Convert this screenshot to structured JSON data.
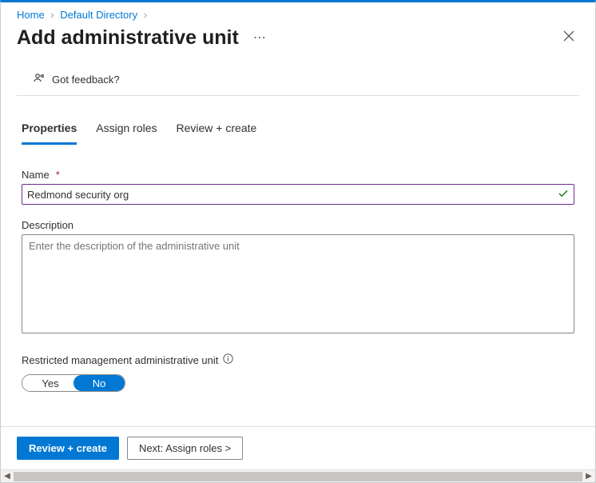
{
  "breadcrumb": {
    "home": "Home",
    "directory": "Default Directory"
  },
  "page": {
    "title": "Add administrative unit",
    "feedback_label": "Got feedback?"
  },
  "tabs": {
    "properties": "Properties",
    "assign_roles": "Assign roles",
    "review_create": "Review + create"
  },
  "form": {
    "name_label": "Name",
    "name_value": "Redmond security org",
    "description_label": "Description",
    "description_placeholder": "Enter the description of the administrative unit",
    "restricted_label": "Restricted management administrative unit",
    "toggle_yes": "Yes",
    "toggle_no": "No"
  },
  "footer": {
    "primary": "Review + create",
    "secondary": "Next: Assign roles >"
  }
}
